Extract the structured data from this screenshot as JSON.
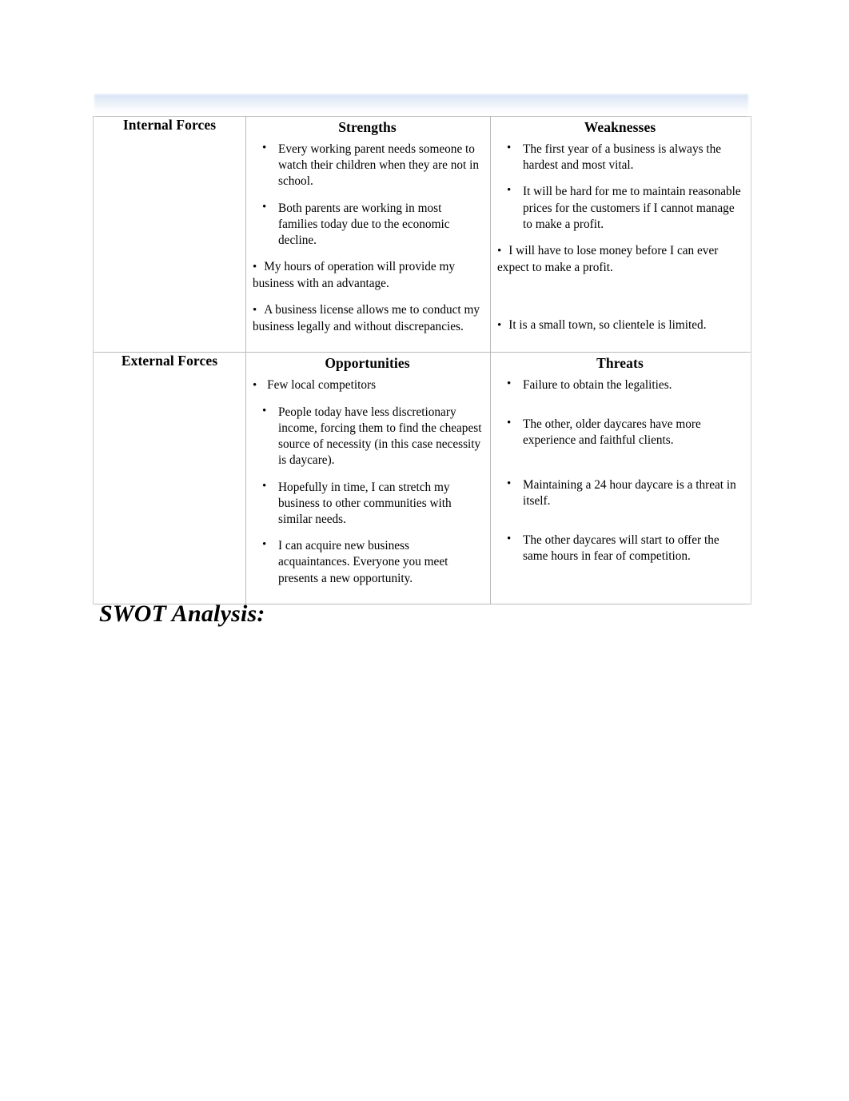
{
  "document": {
    "heading": "SWOT Analysis:"
  },
  "matrix": {
    "rows": [
      {
        "forces_label": "Internal Forces",
        "quadrants": [
          {
            "title": "Strengths",
            "items": [
              {
                "text": "Every working parent needs someone to watch their children when they are not in school.",
                "style": "hang"
              },
              {
                "text": "Both parents are working in most families today due to the economic decline.",
                "style": "hang"
              },
              {
                "text": "My hours of operation will provide my business with an advantage.",
                "style": "flush"
              },
              {
                "text": "A business license allows me to conduct my business legally and without discrepancies.",
                "style": "flush"
              }
            ]
          },
          {
            "title": "Weaknesses",
            "items": [
              {
                "text": "The first year of a business is always the hardest and most vital.",
                "style": "hang"
              },
              {
                "text": "It will be hard for me to maintain reasonable prices for the customers if I cannot manage to make a profit.",
                "style": "hang"
              },
              {
                "text": "I will have to lose money before I can ever expect to make a profit.",
                "style": "flush"
              },
              {
                "text": "It is a small town, so clientele is limited.",
                "style": "flush"
              }
            ]
          }
        ]
      },
      {
        "forces_label": "External Forces",
        "quadrants": [
          {
            "title": "Opportunities",
            "items": [
              {
                "text": "Few  local competitors",
                "style": "flush"
              },
              {
                "text": "People today have less discretionary income, forcing them to find the cheapest source of necessity (in this case necessity is daycare).",
                "style": "hang"
              },
              {
                "text": "Hopefully in time, I can stretch my business to other communities with similar needs.",
                "style": "hang"
              },
              {
                "text": "I can acquire new business acquaintances. Everyone you meet presents a new opportunity.",
                "style": "hang"
              }
            ]
          },
          {
            "title": "Threats",
            "items": [
              {
                "text": "Failure to obtain the legalities.",
                "style": "hang"
              },
              {
                "text": "The other, older daycares have more experience and faithful clients.",
                "style": "hang"
              },
              {
                "text": "Maintaining a 24 hour daycare is a threat in itself.",
                "style": "hang"
              },
              {
                "text": "The other daycares will start to offer the same hours in fear of competition.",
                "style": "hang"
              }
            ]
          }
        ]
      }
    ]
  },
  "colors": {
    "border": "#b9b9b9",
    "text": "#000000",
    "top_band": "#d6e2f3",
    "page_background": "#ffffff"
  }
}
